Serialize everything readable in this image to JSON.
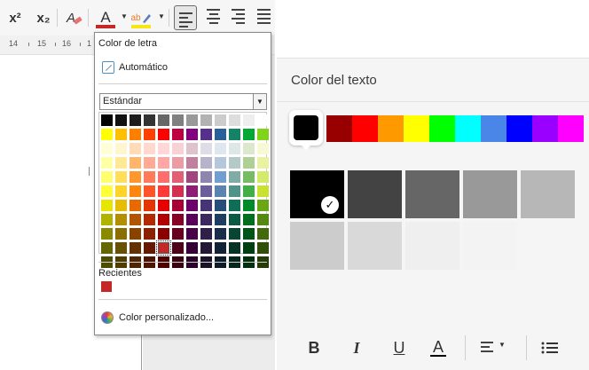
{
  "toolbar": {
    "superscript": "x²",
    "subscript": "x₂",
    "font_color_letter": "A",
    "font_color": "#c62828",
    "highlight_letter": "ab",
    "highlight_color": "#f5e614",
    "icons": [
      "superscript-icon",
      "subscript-icon",
      "clear-formatting-icon",
      "font-color-icon",
      "highlight-icon",
      "align-left-icon",
      "align-center-icon",
      "align-right-icon",
      "justify-icon"
    ]
  },
  "ruler": {
    "numbers": [
      "14",
      "15",
      "16",
      "1"
    ]
  },
  "lo_popup": {
    "title": "Color de letra",
    "automatic": "Automático",
    "palette_name": "Estándar",
    "recent_label": "Recientes",
    "recent_color": "#c62828",
    "custom_label": "Color personalizado...",
    "selected_index": [
      9,
      4
    ],
    "grid": [
      [
        "#000000",
        "#111111",
        "#1c1c1c",
        "#333333",
        "#666666",
        "#808080",
        "#999999",
        "#b2b2b2",
        "#cccccc",
        "#dddddd",
        "#eeeeee",
        "#ffffff"
      ],
      [
        "#ffff00",
        "#ffbf00",
        "#ff8000",
        "#ff4000",
        "#ff0000",
        "#bf0041",
        "#800080",
        "#55308d",
        "#2a6099",
        "#158466",
        "#00a933",
        "#81d41a"
      ],
      [
        "#ffffd7",
        "#fff5ce",
        "#ffdbb6",
        "#ffd8ce",
        "#ffd7d7",
        "#f7d1d5",
        "#e0c2cd",
        "#dedce6",
        "#dee6ef",
        "#dee7e5",
        "#dde8cb",
        "#f6f9d4"
      ],
      [
        "#ffffa6",
        "#ffe994",
        "#ffb66c",
        "#ffaa95",
        "#ffa6a6",
        "#ec9ba4",
        "#bf819e",
        "#b7b3ca",
        "#b4c7dc",
        "#b3cac7",
        "#afd095",
        "#e8f2a1"
      ],
      [
        "#ffff6d",
        "#ffde59",
        "#ff972f",
        "#ff7b59",
        "#ff6d6d",
        "#e16173",
        "#a1467e",
        "#8e86ae",
        "#729fcf",
        "#81aca6",
        "#77bc65",
        "#d4ea6b"
      ],
      [
        "#ffff38",
        "#ffd428",
        "#ff860d",
        "#ff5429",
        "#ff3838",
        "#d62e4e",
        "#8d1d75",
        "#6b5e9b",
        "#5983b0",
        "#50938a",
        "#3faf46",
        "#c9e130"
      ],
      [
        "#e6e600",
        "#e6bd00",
        "#e66a00",
        "#e63400",
        "#e60000",
        "#a60036",
        "#6b006b",
        "#453476",
        "#254e79",
        "#0f6e56",
        "#008b2a",
        "#6aa813"
      ],
      [
        "#b2b200",
        "#b28f00",
        "#b25500",
        "#b22a00",
        "#b20000",
        "#860028",
        "#590059",
        "#3b2a60",
        "#1e3e61",
        "#0b5a44",
        "#006e21",
        "#55880e"
      ],
      [
        "#8a8a00",
        "#8a6f00",
        "#8a4200",
        "#8a2100",
        "#8a0000",
        "#67001f",
        "#480048",
        "#2e2049",
        "#182f4b",
        "#084533",
        "#005418",
        "#42690b"
      ],
      [
        "#666600",
        "#665200",
        "#663100",
        "#661800",
        "#c62828",
        "#4d0017",
        "#350035",
        "#231835",
        "#122338",
        "#063326",
        "#003f12",
        "#324f08"
      ],
      [
        "#4d4d00",
        "#4d3e00",
        "#4d2500",
        "#4d1200",
        "#4d0000",
        "#3a0011",
        "#280028",
        "#1a1228",
        "#0d1a2a",
        "#04261c",
        "#002f0d",
        "#253c06"
      ]
    ]
  },
  "mobile": {
    "title": "Color del texto",
    "selected_hue": "#000000",
    "hues": [
      "#980000",
      "#ff0000",
      "#ff9900",
      "#ffff00",
      "#00ff00",
      "#00ffff",
      "#4a86e8",
      "#0000ff",
      "#9900ff",
      "#ff00ff"
    ],
    "shades": [
      "#000000",
      "#434343",
      "#666666",
      "#999999",
      "#b7b7b7",
      "#cccccc",
      "#d9d9d9",
      "#efefef",
      "#f3f3f3",
      "#f5f5f5"
    ],
    "checked_shade": 0,
    "toolbar": {
      "bold": "B",
      "italic": "I",
      "underline": "U",
      "text_color": "A",
      "icons": [
        "bold-icon",
        "italic-icon",
        "underline-icon",
        "text-color-icon",
        "align-icon",
        "list-icon"
      ]
    }
  }
}
